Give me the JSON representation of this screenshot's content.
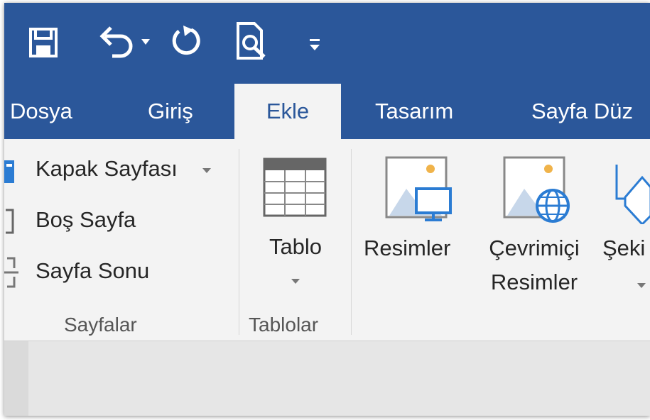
{
  "quick_access": {
    "icons": [
      "save-icon",
      "undo-icon",
      "undo-dropdown-icon",
      "redo-icon",
      "print-preview-icon",
      "customize-qat-icon"
    ]
  },
  "tabs": [
    {
      "label": "Dosya"
    },
    {
      "label": "Giriş"
    },
    {
      "label": "Ekle",
      "active": true
    },
    {
      "label": "Tasarım"
    },
    {
      "label": "Sayfa Düz"
    }
  ],
  "groups": {
    "pages": {
      "label": "Sayfalar",
      "items": [
        {
          "label": "Kapak Sayfası",
          "icon": "cover-page-icon",
          "has_dropdown": true
        },
        {
          "label": "Boş Sayfa",
          "icon": "blank-page-icon"
        },
        {
          "label": "Sayfa Sonu",
          "icon": "page-break-icon"
        }
      ]
    },
    "tables": {
      "label": "Tablolar",
      "table_button": {
        "label": "Tablo",
        "icon": "table-icon"
      }
    },
    "illustrations": {
      "pictures": {
        "label": "Resimler",
        "icon": "pictures-icon"
      },
      "online_pictures": {
        "label_line1": "Çevrimiçi",
        "label_line2": "Resimler",
        "icon": "online-pictures-icon"
      },
      "shapes": {
        "label": "Şeki",
        "icon": "shapes-icon"
      }
    }
  },
  "colors": {
    "accent": "#2b579a",
    "ribbon_bg": "#f3f3f3",
    "icon_orange": "#f0b34a",
    "icon_blue": "#2b7cd3"
  }
}
